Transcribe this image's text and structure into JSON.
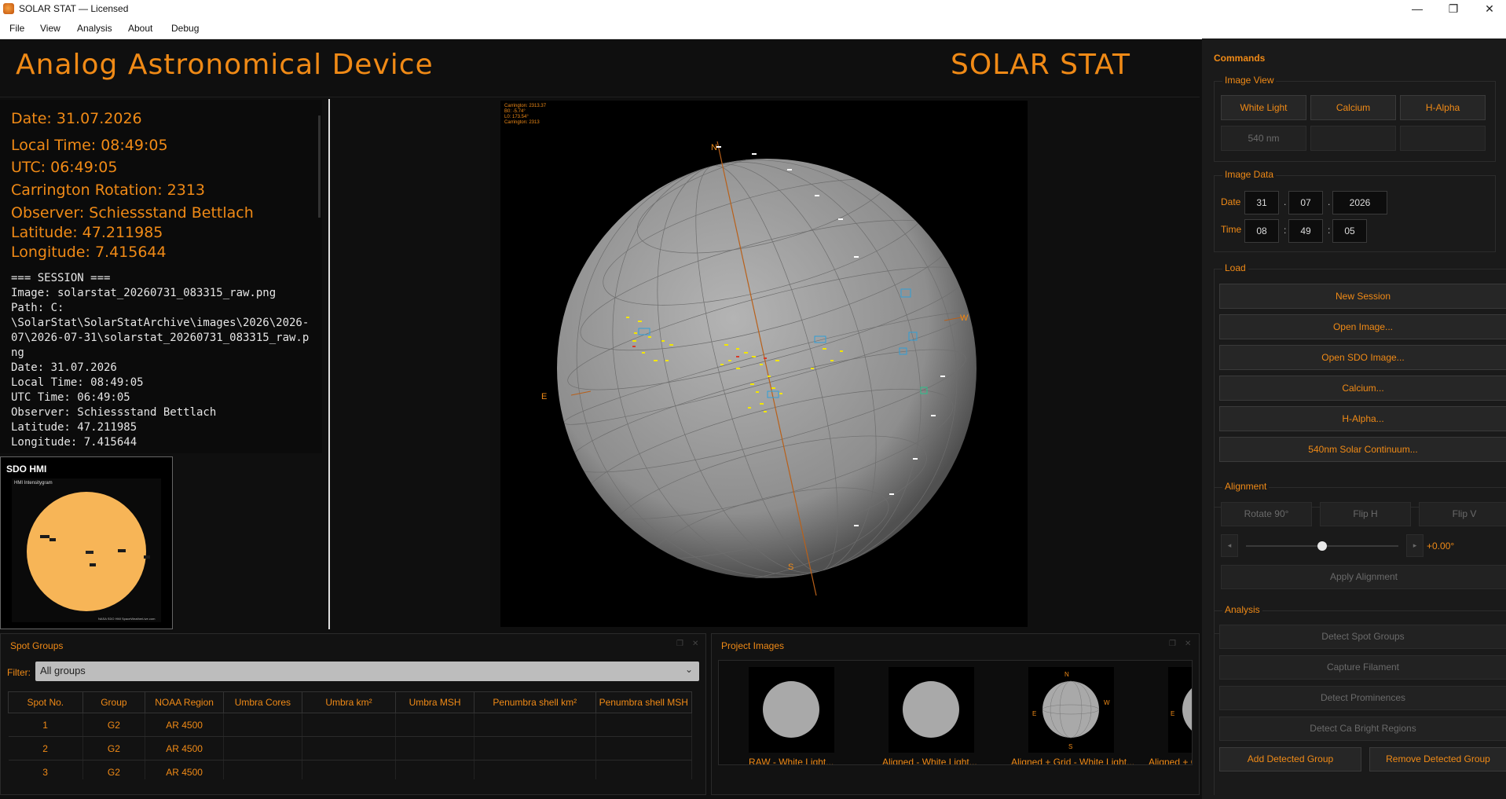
{
  "window": {
    "title": "SOLAR STAT — Licensed",
    "minimize": "—",
    "maximize": "❐",
    "close": "✕"
  },
  "menu": [
    "File",
    "View",
    "Analysis",
    "About",
    "Debug"
  ],
  "header": {
    "left_title": "Analog Astronomical Device",
    "right_title": "SOLAR STAT"
  },
  "info": {
    "date": "Date: 31.07.2026",
    "local_time": "Local Time: 08:49:05",
    "utc": "UTC: 06:49:05",
    "carrington": "Carrington Rotation: 2313",
    "observer": "Observer: Schiessstand Bettlach",
    "latitude": "Latitude: 47.211985",
    "longitude": "Longitude: 7.415644",
    "session": "=== SESSION ===\nImage: solarstat_20260731_083315_raw.png\nPath: C:\n\\SolarStat\\SolarStatArchive\\images\\2026\\2026-07\\2026-07-31\\solarstat_20260731_083315_raw.png\nDate: 31.07.2026\nLocal Time: 08:49:05\nUTC Time: 06:49:05\nObserver: Schiessstand Bettlach\nLatitude: 47.211985\nLongitude: 7.415644"
  },
  "sdo": {
    "panel_title": "SDO HMI",
    "image_caption": "HMI Intensitygram",
    "credit": "NASA SDO HMI SpaceWeatherLive.com"
  },
  "main_image": {
    "overlay_text": [
      "Carrington: 2313.37",
      "B0: -5.74°",
      "L0: 173.54°",
      "Carrington: 2313"
    ],
    "compass": {
      "n": "N",
      "s": "S",
      "e": "E",
      "w": "W"
    }
  },
  "commands": {
    "title": "Commands",
    "image_view": {
      "label": "Image View",
      "buttons": [
        "White Light",
        "Calcium",
        "H-Alpha",
        "540 nm",
        "",
        ""
      ]
    },
    "image_data": {
      "label": "Image Data",
      "date_label": "Date",
      "time_label": "Time",
      "day": "31",
      "month": "07",
      "year": "2026",
      "hour": "08",
      "minute": "49",
      "second": "05",
      "date_sep": ".",
      "time_sep": ":"
    },
    "load": {
      "label": "Load",
      "buttons": [
        "New Session",
        "Open Image...",
        "Open SDO Image...",
        "Calcium...",
        "H-Alpha...",
        "540nm Solar Continuum..."
      ]
    },
    "alignment": {
      "label": "Alignment",
      "buttons": [
        "Rotate 90°",
        "Flip H",
        "Flip V"
      ],
      "slider_value": "+0.00°",
      "slider_position": 0.5,
      "left_arrow": "◂",
      "right_arrow": "▸",
      "apply": "Apply Alignment"
    },
    "analysis": {
      "label": "Analysis",
      "buttons": [
        "Detect Spot Groups",
        "Capture Filament",
        "Detect Prominences",
        "Detect Ca Bright Regions"
      ],
      "add": "Add Detected Group",
      "remove": "Remove Detected Group"
    }
  },
  "spot_groups": {
    "title": "Spot Groups",
    "filter_label": "Filter:",
    "filter_value": "All groups",
    "columns": [
      "Spot No.",
      "Group",
      "NOAA Region",
      "Umbra Cores",
      "Umbra km²",
      "Umbra MSH",
      "Penumbra shell km²",
      "Penumbra shell MSH"
    ],
    "rows": [
      [
        "1",
        "G2",
        "AR 4500",
        "",
        "",
        "",
        "",
        ""
      ],
      [
        "2",
        "G2",
        "AR 4500",
        "",
        "",
        "",
        "",
        ""
      ],
      [
        "3",
        "G2",
        "AR 4500",
        "",
        "",
        "",
        "",
        ""
      ]
    ]
  },
  "project_images": {
    "title": "Project Images",
    "items": [
      "RAW - White Light...",
      "Aligned - White Light...",
      "Aligned + Grid - White Light...",
      "Aligned + G"
    ]
  },
  "colors": {
    "accent": "#f08a16",
    "background": "#0f0f0f",
    "panel": "#1a1a1a",
    "spot_yellow": "#f2e600",
    "marker_blue": "#2f9fd8"
  }
}
